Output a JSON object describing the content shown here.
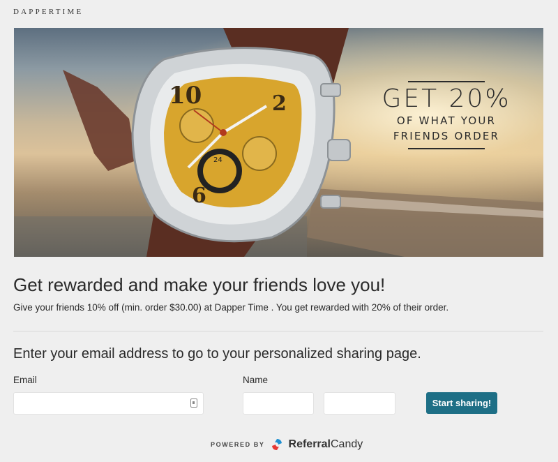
{
  "brand": {
    "name": "DAPPERTIME"
  },
  "banner": {
    "line1": "GET 20%",
    "line2": "OF WHAT YOUR",
    "line3": "FRIENDS ORDER"
  },
  "headline": "Get rewarded and make your friends love you!",
  "subtext": "Give your friends 10% off (min. order $30.00) at Dapper Time . You get rewarded with 20% of their order.",
  "form": {
    "prompt": "Enter your email address to go to your personalized sharing page.",
    "email_label": "Email",
    "email_value": "",
    "name_label": "Name",
    "first_name_value": "",
    "last_name_value": "",
    "submit_label": "Start sharing!"
  },
  "footer": {
    "powered_by": "POWERED BY",
    "provider_a": "Referral",
    "provider_b": "Candy"
  },
  "colors": {
    "accent": "#1e6f86",
    "background": "#efefef"
  }
}
